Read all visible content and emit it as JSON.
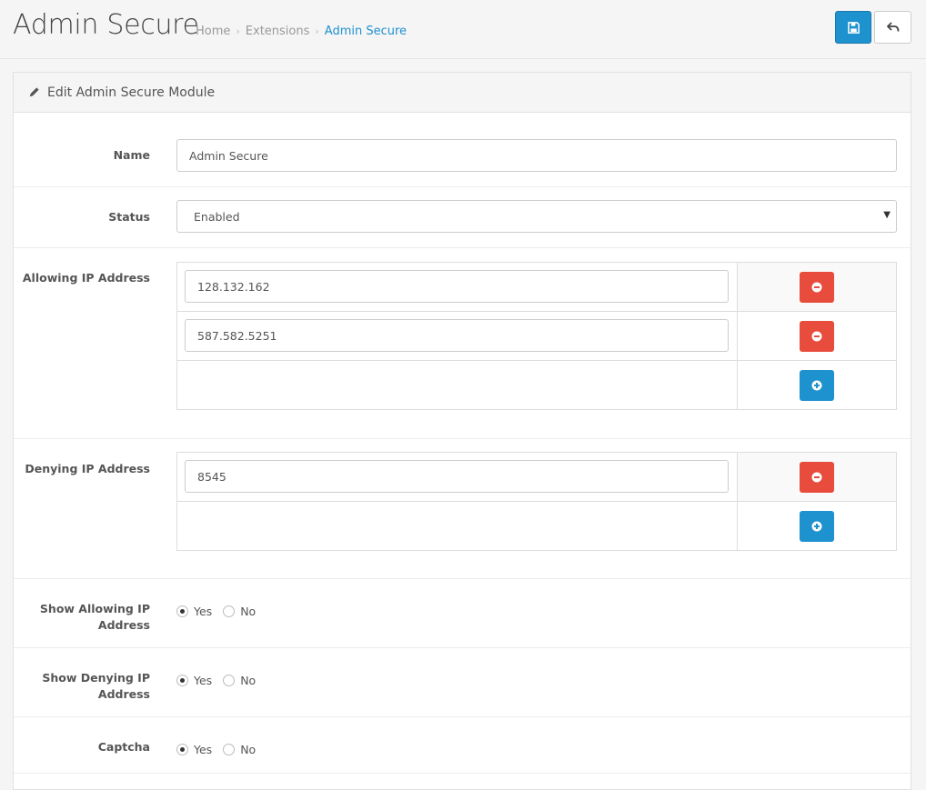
{
  "header": {
    "title": "Admin Secure",
    "breadcrumbs": [
      "Home",
      "Extensions",
      "Admin Secure"
    ],
    "save_icon": "save-icon",
    "back_icon": "reply-icon"
  },
  "panel": {
    "heading": "Edit Admin Secure Module",
    "heading_icon": "pencil-icon"
  },
  "form": {
    "name_label": "Name",
    "name_value": "Admin Secure",
    "status_label": "Status",
    "status_value": "Enabled",
    "allowing_label": "Allowing IP Address",
    "allowing_ips": [
      "128.132.162",
      "587.582.5251"
    ],
    "denying_label": "Denying IP Address",
    "denying_ips": [
      "8545"
    ],
    "show_allowing_label": "Show Allowing IP Address",
    "show_denying_label": "Show Denying IP Address",
    "captcha_label": "Captcha",
    "yes": "Yes",
    "no": "No"
  },
  "colors": {
    "primary": "#1e91cf",
    "danger": "#e74c3c"
  }
}
